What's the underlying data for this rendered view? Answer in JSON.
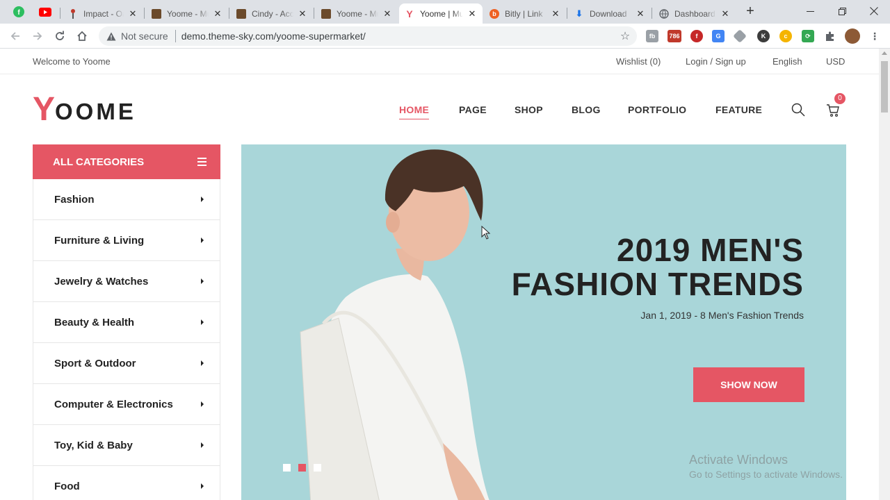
{
  "browser": {
    "tabs": [
      {
        "title": "Impact - Oa",
        "favicon_color": "#c0392b"
      },
      {
        "title": "Yoome - Mu",
        "favicon_color": "#6b4a2b"
      },
      {
        "title": "Cindy - Acc",
        "favicon_color": "#6b4a2b"
      },
      {
        "title": "Yoome - Mu",
        "favicon_color": "#6b4a2b"
      },
      {
        "title": "Yoome | Mu",
        "favicon_color": "#e55664",
        "active": true
      },
      {
        "title": "Bitly | Link",
        "favicon_color": "#ee6123"
      },
      {
        "title": "Download",
        "favicon_color": "#1a73e8"
      },
      {
        "title": "Dashboard",
        "favicon_color": "#5f6368"
      }
    ],
    "address": {
      "security": "Not secure",
      "url": "demo.theme-sky.com/yoome-supermarket/"
    }
  },
  "topbar": {
    "welcome": "Welcome to Yoome",
    "wishlist": "Wishlist (0)",
    "login": "Login / Sign up",
    "language": "English",
    "currency": "USD"
  },
  "logo": {
    "first": "Y",
    "rest": "OOME"
  },
  "nav": [
    "HOME",
    "PAGE",
    "SHOP",
    "BLOG",
    "PORTFOLIO",
    "FEATURE"
  ],
  "cart_count": "0",
  "categories": {
    "heading": "ALL CATEGORIES",
    "items": [
      "Fashion",
      "Furniture & Living",
      "Jewelry & Watches",
      "Beauty & Health",
      "Sport & Outdoor",
      "Computer & Electronics",
      "Toy, Kid & Baby",
      "Food"
    ]
  },
  "hero": {
    "title_line1": "2019 MEN'S",
    "title_line2": "FASHION TRENDS",
    "subtitle": "Jan 1, 2019 - 8 Men's Fashion Trends",
    "button": "SHOW NOW"
  },
  "watermark": {
    "line1": "Activate Windows",
    "line2": "Go to Settings to activate Windows."
  },
  "colors": {
    "accent": "#e55664",
    "hero_bg": "#a9d6d9"
  }
}
